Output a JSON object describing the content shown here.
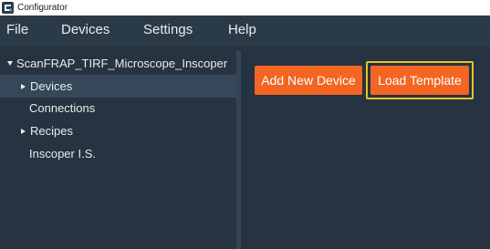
{
  "window": {
    "title": "Configurator",
    "app_icon": "configurator-app-icon"
  },
  "menu": {
    "items": [
      {
        "label": "File"
      },
      {
        "label": "Devices"
      },
      {
        "label": "Settings"
      },
      {
        "label": "Help"
      }
    ]
  },
  "tree": {
    "root": {
      "label": "ScanFRAP_TIRF_Microscope_Inscoper",
      "expanded": true
    },
    "children": [
      {
        "label": "Devices",
        "expandable": true,
        "selected": true
      },
      {
        "label": "Connections",
        "expandable": false,
        "selected": false
      },
      {
        "label": "Recipes",
        "expandable": true,
        "selected": false
      },
      {
        "label": "Inscoper I.S.",
        "expandable": false,
        "selected": false
      }
    ]
  },
  "actions": {
    "add_device_label": "Add New Device",
    "load_template_label": "Load Template"
  },
  "colors": {
    "menubar_bg": "#2b3a47",
    "panel_bg": "#263340",
    "selection_bg": "#354758",
    "button_accent": "#f26522",
    "highlight_frame": "#e8c32a",
    "text": "#e8ecef"
  }
}
